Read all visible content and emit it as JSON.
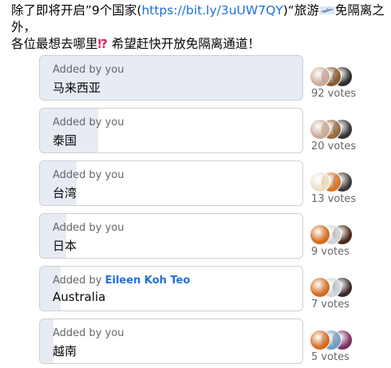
{
  "post": {
    "line1_a": "除了即将开启”9个国家(",
    "link": "https://bit.ly/3uUW7QY",
    "line1_b": ")“旅游",
    "line1_c": "免隔离之外，",
    "line2_a": "各位最想去哪里",
    "line2_b": "希望赶快开放免隔离通道！",
    "icons": [
      "airplane-emoji",
      "exclamation-question-emoji"
    ]
  },
  "poll": {
    "options": [
      {
        "meta_prefix": "Added by ",
        "author": "you",
        "label": "马来西亚",
        "votes_text": "92 votes",
        "votes": 92,
        "fill_fraction": 1.0,
        "avatar_colors": [
          "#c9a99a",
          "#8a5a2b",
          "#2c2c2c"
        ]
      },
      {
        "meta_prefix": "Added by ",
        "author": "you",
        "label": "泰国",
        "votes_text": "20 votes",
        "votes": 20,
        "fill_fraction": 0.22,
        "avatar_colors": [
          "#c9a99a",
          "#9a6a3a",
          "#333333"
        ]
      },
      {
        "meta_prefix": "Added by ",
        "author": "you",
        "label": "台湾",
        "votes_text": "13 votes",
        "votes": 13,
        "fill_fraction": 0.14,
        "avatar_colors": [
          "#e8e0c8",
          "#d9742a",
          "#3a3a3a"
        ]
      },
      {
        "meta_prefix": "Added by ",
        "author": "you",
        "label": "日本",
        "votes_text": "9 votes",
        "votes": 9,
        "fill_fraction": 0.1,
        "avatar_colors": [
          "#d46a1e",
          "#d0d3d8",
          "#4a2a1a"
        ]
      },
      {
        "meta_prefix": "Added by ",
        "author": "Eileen Koh Teo",
        "label": "Australia",
        "votes_text": "7 votes",
        "votes": 7,
        "fill_fraction": 0.08,
        "avatar_colors": [
          "#d46a1e",
          "#d0d3d8",
          "#3a2a2a"
        ]
      },
      {
        "meta_prefix": "Added by ",
        "author": "you",
        "label": "越南",
        "votes_text": "5 votes",
        "votes": 5,
        "fill_fraction": 0.05,
        "avatar_colors": [
          "#d46a1e",
          "#6fa0c0",
          "#7a3060"
        ]
      }
    ]
  }
}
